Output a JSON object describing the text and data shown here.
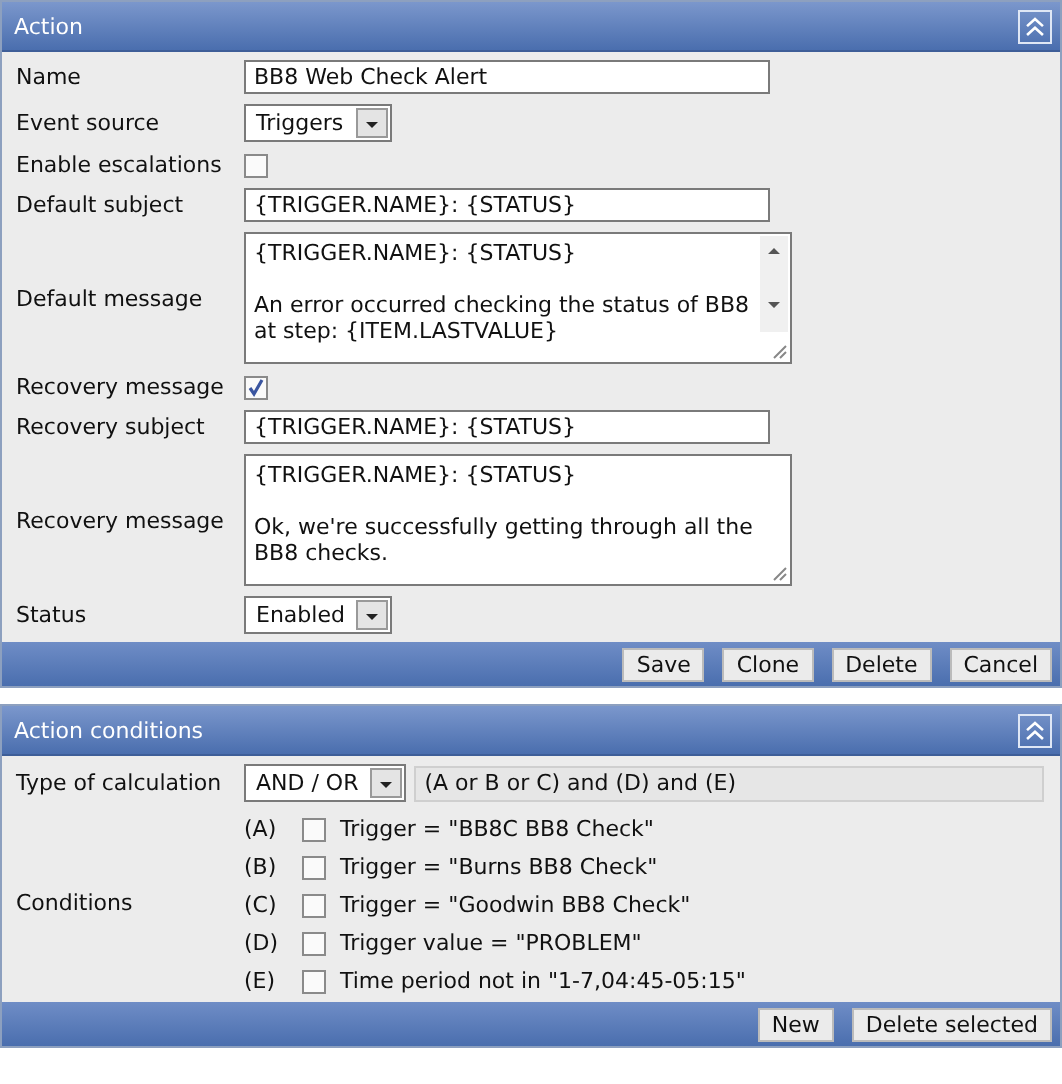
{
  "action_panel": {
    "title": "Action",
    "fields": [
      {
        "kind": "text",
        "label": "Name",
        "value": "BB8 Web Check Alert"
      },
      {
        "kind": "select",
        "label": "Event source",
        "value": "Triggers"
      },
      {
        "kind": "checkbox",
        "label": "Enable escalations",
        "checked": false
      },
      {
        "kind": "text",
        "label": "Default subject",
        "value": "{TRIGGER.NAME}: {STATUS}"
      },
      {
        "kind": "textarea",
        "label": "Default message",
        "value": "{TRIGGER.NAME}: {STATUS}\n\nAn error occurred checking the status of BB8\nat step: {ITEM.LASTVALUE}",
        "scrollable": true
      },
      {
        "kind": "checkbox",
        "label": "Recovery message",
        "checked": true
      },
      {
        "kind": "text",
        "label": "Recovery subject",
        "value": "{TRIGGER.NAME}: {STATUS}"
      },
      {
        "kind": "textarea",
        "label": "Recovery message",
        "value": "{TRIGGER.NAME}: {STATUS}\n\nOk, we're successfully getting through all the\nBB8 checks.",
        "scrollable": false
      },
      {
        "kind": "select",
        "label": "Status",
        "value": "Enabled"
      }
    ],
    "buttons": [
      "Save",
      "Clone",
      "Delete",
      "Cancel"
    ]
  },
  "conditions_panel": {
    "title": "Action conditions",
    "calculation": {
      "label": "Type of calculation",
      "value": "AND / OR",
      "formula": "(A or B or C) and (D) and (E)"
    },
    "conditions": {
      "label": "Conditions",
      "items": [
        {
          "letter": "(A)",
          "text": "Trigger = \"BB8C BB8 Check\"",
          "checked": false
        },
        {
          "letter": "(B)",
          "text": "Trigger = \"Burns BB8 Check\"",
          "checked": false
        },
        {
          "letter": "(C)",
          "text": "Trigger = \"Goodwin BB8 Check\"",
          "checked": false
        },
        {
          "letter": "(D)",
          "text": "Trigger value = \"PROBLEM\"",
          "checked": false
        },
        {
          "letter": "(E)",
          "text": "Time period not in \"1-7,04:45-05:15\"",
          "checked": false
        }
      ]
    },
    "buttons": [
      "New",
      "Delete selected"
    ]
  }
}
